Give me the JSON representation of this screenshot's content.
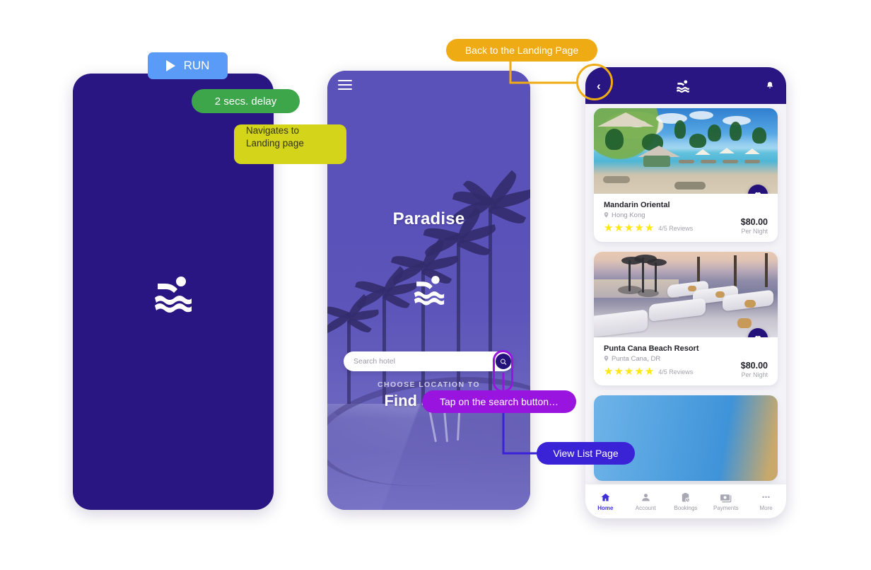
{
  "annotations": {
    "run_button": {
      "label": "RUN",
      "icon": "play-icon",
      "color": "#5B9BF8"
    },
    "delay_pill": {
      "label": "2 secs. delay",
      "color": "#3DA64A"
    },
    "navigates_box": {
      "line1": "Navigates to",
      "line2": "Landing page",
      "color": "#D4D41A"
    },
    "back_pill": {
      "label": "Back to the Landing Page",
      "color": "#EFAB13"
    },
    "tap_pill": {
      "label": "Tap on the search button…",
      "color": "#9A14E0"
    },
    "view_pill": {
      "label": "View List Page",
      "color": "#3A22D6"
    }
  },
  "splash_screen": {
    "background": "#2A1682",
    "logo": "swimmer-icon"
  },
  "landing_screen": {
    "menu_icon": "hamburger-icon",
    "brand": "Paradise",
    "logo": "swimmer-icon",
    "eyebrow": "CHOOSE LOCATION TO",
    "headline": "Find a Hotel",
    "search": {
      "placeholder": "Search hotel",
      "value": "",
      "button_icon": "search-icon"
    }
  },
  "list_screen": {
    "appbar": {
      "back_icon": "chevron-left-icon",
      "logo": "swimmer-icon",
      "notifications_icon": "bell-icon"
    },
    "hotels": [
      {
        "name": "Mandarin Oriental",
        "location": "Hong Kong",
        "stars": "★★★★★",
        "reviews": "4/5 Reviews",
        "price": "$80.00",
        "price_unit": "Per Night",
        "favorite_icon": "heart-icon",
        "photo": "tropical-pool"
      },
      {
        "name": "Punta Cana Beach Resort",
        "location": "Punta Cana, DR",
        "stars": "★★★★★",
        "reviews": "4/5 Reviews",
        "price": "$80.00",
        "price_unit": "Per Night",
        "favorite_icon": "heart-icon",
        "photo": "sunset-loungers"
      }
    ],
    "tabs": [
      {
        "label": "Home",
        "icon": "home-icon",
        "active": true
      },
      {
        "label": "Account",
        "icon": "person-icon",
        "active": false
      },
      {
        "label": "Bookings",
        "icon": "clipboard-clock-icon",
        "active": false
      },
      {
        "label": "Payments",
        "icon": "money-icon",
        "active": false
      },
      {
        "label": "More",
        "icon": "ellipsis-icon",
        "active": false
      }
    ]
  }
}
